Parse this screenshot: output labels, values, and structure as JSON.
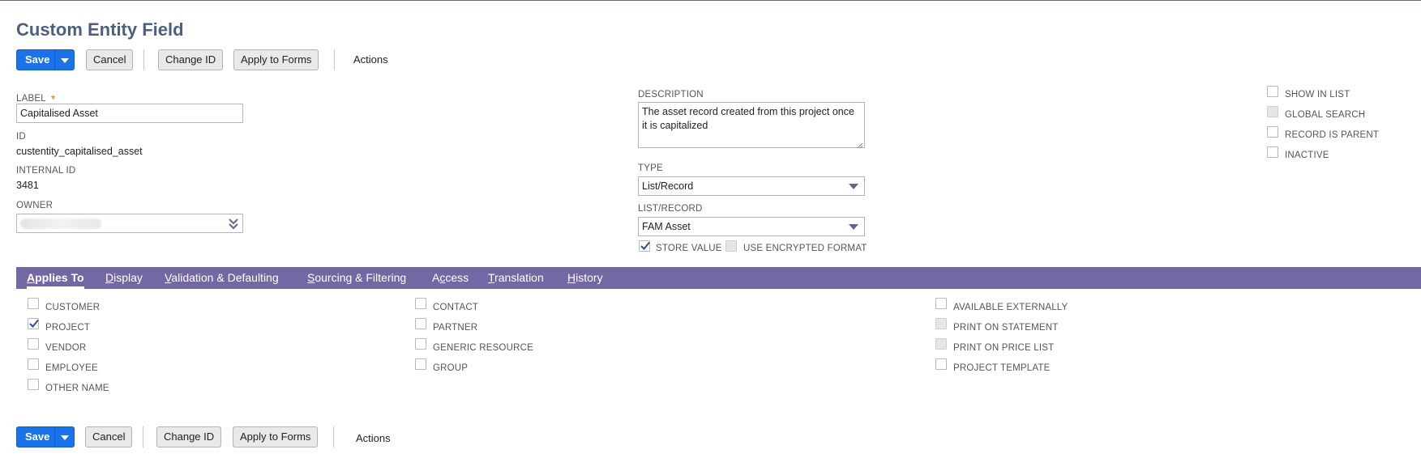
{
  "page": {
    "title": "Custom Entity Field"
  },
  "toolbar": {
    "save_label": "Save",
    "cancel_label": "Cancel",
    "change_id_label": "Change ID",
    "apply_forms_label": "Apply to Forms",
    "actions_label": "Actions"
  },
  "fields": {
    "label": {
      "label": "LABEL",
      "required": "*",
      "value": "Capitalised Asset"
    },
    "id": {
      "label": "ID",
      "value": "custentity_capitalised_asset"
    },
    "internal_id": {
      "label": "INTERNAL ID",
      "value": "3481"
    },
    "owner": {
      "label": "OWNER"
    },
    "description": {
      "label": "DESCRIPTION",
      "value": "The asset record created from this project once it is capitalized"
    },
    "type": {
      "label": "TYPE",
      "value": "List/Record"
    },
    "list_record": {
      "label": "LIST/RECORD",
      "value": "FAM Asset"
    },
    "store_value": {
      "label": "STORE VALUE",
      "checked": true
    },
    "use_encrypted": {
      "label": "USE ENCRYPTED FORMAT",
      "checked": false
    }
  },
  "right_checks": [
    {
      "label": "SHOW IN LIST",
      "checked": false,
      "disabled": false
    },
    {
      "label": "GLOBAL SEARCH",
      "checked": false,
      "disabled": true
    },
    {
      "label": "RECORD IS PARENT",
      "checked": false,
      "disabled": false
    },
    {
      "label": "INACTIVE",
      "checked": false,
      "disabled": false
    }
  ],
  "tabs": [
    {
      "label_u": "A",
      "label_rest": "pplies To",
      "active": true
    },
    {
      "label_u": "D",
      "label_rest": "isplay"
    },
    {
      "label_u": "V",
      "label_rest": "alidation & Defaulting"
    },
    {
      "label_u": "S",
      "label_rest": "ourcing & Filtering"
    },
    {
      "label_pre": "A",
      "label_u": "c",
      "label_rest": "cess"
    },
    {
      "label_u": "T",
      "label_rest": "ranslation"
    },
    {
      "label_u": "H",
      "label_rest": "istory"
    }
  ],
  "applies_to": {
    "col1": [
      {
        "label": "CUSTOMER",
        "checked": false
      },
      {
        "label": "PROJECT",
        "checked": true
      },
      {
        "label": "VENDOR",
        "checked": false
      },
      {
        "label": "EMPLOYEE",
        "checked": false
      },
      {
        "label": "OTHER NAME",
        "checked": false
      }
    ],
    "col2": [
      {
        "label": "CONTACT",
        "checked": false
      },
      {
        "label": "PARTNER",
        "checked": false
      },
      {
        "label": "GENERIC RESOURCE",
        "checked": false
      },
      {
        "label": "GROUP",
        "checked": false
      }
    ],
    "col3": [
      {
        "label": "AVAILABLE EXTERNALLY",
        "checked": false,
        "disabled": false
      },
      {
        "label": "PRINT ON STATEMENT",
        "checked": false,
        "disabled": true
      },
      {
        "label": "PRINT ON PRICE LIST",
        "checked": false,
        "disabled": true
      },
      {
        "label": "PROJECT TEMPLATE",
        "checked": false,
        "disabled": false
      }
    ]
  },
  "colors": {
    "accent": "#1a73e8",
    "tabbar": "#7468a4",
    "title": "#4d5f7e"
  }
}
